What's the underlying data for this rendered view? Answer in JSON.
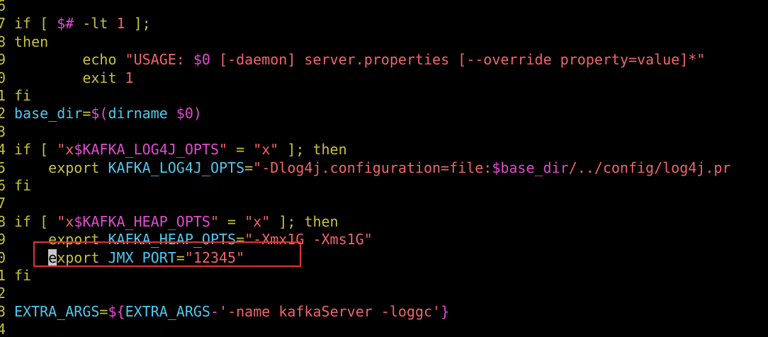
{
  "colors": {
    "background": "#000000",
    "line_number": "#c8c23a",
    "keyword": "#c8c23a",
    "plain": "#4ec9f0",
    "string": "#f2646a",
    "variable": "#e14bd0",
    "highlight_box": "#e0352b"
  },
  "highlight": {
    "line_index": 13,
    "description": "red rectangle around JMX_PORT export line"
  },
  "lines": [
    {
      "num": "6",
      "tokens": []
    },
    {
      "num": "7",
      "tokens": [
        {
          "t": "if [ ",
          "c": "keyword"
        },
        {
          "t": "$#",
          "c": "variable"
        },
        {
          "t": " -lt ",
          "c": "keyword"
        },
        {
          "t": "1",
          "c": "string"
        },
        {
          "t": " ];",
          "c": "keyword"
        }
      ]
    },
    {
      "num": "8",
      "tokens": [
        {
          "t": "then",
          "c": "keyword"
        }
      ]
    },
    {
      "num": "9",
      "tokens": [
        {
          "t": "        echo ",
          "c": "keyword"
        },
        {
          "t": "\"USAGE: ",
          "c": "string"
        },
        {
          "t": "$0",
          "c": "variable"
        },
        {
          "t": " [-daemon] server.properties [--override property=value]*\"",
          "c": "string"
        }
      ]
    },
    {
      "num": "0",
      "tokens": [
        {
          "t": "        exit ",
          "c": "keyword"
        },
        {
          "t": "1",
          "c": "string"
        }
      ]
    },
    {
      "num": "1",
      "tokens": [
        {
          "t": "fi",
          "c": "keyword"
        }
      ]
    },
    {
      "num": "2",
      "tokens": [
        {
          "t": "base_dir",
          "c": "plain"
        },
        {
          "t": "=",
          "c": "keyword"
        },
        {
          "t": "$(",
          "c": "variable"
        },
        {
          "t": "dirname ",
          "c": "plain"
        },
        {
          "t": "$0",
          "c": "variable"
        },
        {
          "t": ")",
          "c": "variable"
        }
      ]
    },
    {
      "num": "3",
      "tokens": []
    },
    {
      "num": "4",
      "tokens": [
        {
          "t": "if [ ",
          "c": "keyword"
        },
        {
          "t": "\"x",
          "c": "string"
        },
        {
          "t": "$KAFKA_LOG4J_OPTS",
          "c": "variable"
        },
        {
          "t": "\"",
          "c": "string"
        },
        {
          "t": " = ",
          "c": "keyword"
        },
        {
          "t": "\"x\"",
          "c": "string"
        },
        {
          "t": " ]; then",
          "c": "keyword"
        }
      ]
    },
    {
      "num": "5",
      "tokens": [
        {
          "t": "    export ",
          "c": "keyword"
        },
        {
          "t": "KAFKA_LOG4J_OPTS",
          "c": "plain"
        },
        {
          "t": "=",
          "c": "keyword"
        },
        {
          "t": "\"-Dlog4j.configuration=file:",
          "c": "string"
        },
        {
          "t": "$base_dir",
          "c": "variable"
        },
        {
          "t": "/../config/log4j.pr",
          "c": "string"
        }
      ]
    },
    {
      "num": "6",
      "tokens": [
        {
          "t": "fi",
          "c": "keyword"
        }
      ]
    },
    {
      "num": "7",
      "tokens": []
    },
    {
      "num": "8",
      "tokens": [
        {
          "t": "if [ ",
          "c": "keyword"
        },
        {
          "t": "\"x",
          "c": "string"
        },
        {
          "t": "$KAFKA_HEAP_OPTS",
          "c": "variable"
        },
        {
          "t": "\"",
          "c": "string"
        },
        {
          "t": " = ",
          "c": "keyword"
        },
        {
          "t": "\"x\"",
          "c": "string"
        },
        {
          "t": " ]; then",
          "c": "keyword"
        }
      ]
    },
    {
      "num": "9",
      "tokens": [
        {
          "t": "    export ",
          "c": "keyword"
        },
        {
          "t": "KAFKA_HEAP_OPTS",
          "c": "plain"
        },
        {
          "t": "=",
          "c": "keyword"
        },
        {
          "t": "\"-Xmx1G -Xms1G\"",
          "c": "string"
        }
      ]
    },
    {
      "num": "0",
      "tokens": [
        {
          "t": "    ",
          "c": "keyword"
        },
        {
          "t": "e",
          "c": "cursor"
        },
        {
          "t": "xport ",
          "c": "keyword"
        },
        {
          "t": "JMX_PORT",
          "c": "plain"
        },
        {
          "t": "=",
          "c": "keyword"
        },
        {
          "t": "\"12345\"",
          "c": "string"
        }
      ]
    },
    {
      "num": "1",
      "tokens": [
        {
          "t": "fi",
          "c": "keyword"
        }
      ]
    },
    {
      "num": "2",
      "tokens": []
    },
    {
      "num": "3",
      "tokens": [
        {
          "t": "EXTRA_ARGS",
          "c": "plain"
        },
        {
          "t": "=",
          "c": "keyword"
        },
        {
          "t": "${",
          "c": "variable"
        },
        {
          "t": "EXTRA_ARGS",
          "c": "plain"
        },
        {
          "t": "-",
          "c": "variable"
        },
        {
          "t": "'-name kafkaServer -loggc'",
          "c": "string"
        },
        {
          "t": "}",
          "c": "variable"
        }
      ]
    },
    {
      "num": "4",
      "tokens": []
    }
  ]
}
